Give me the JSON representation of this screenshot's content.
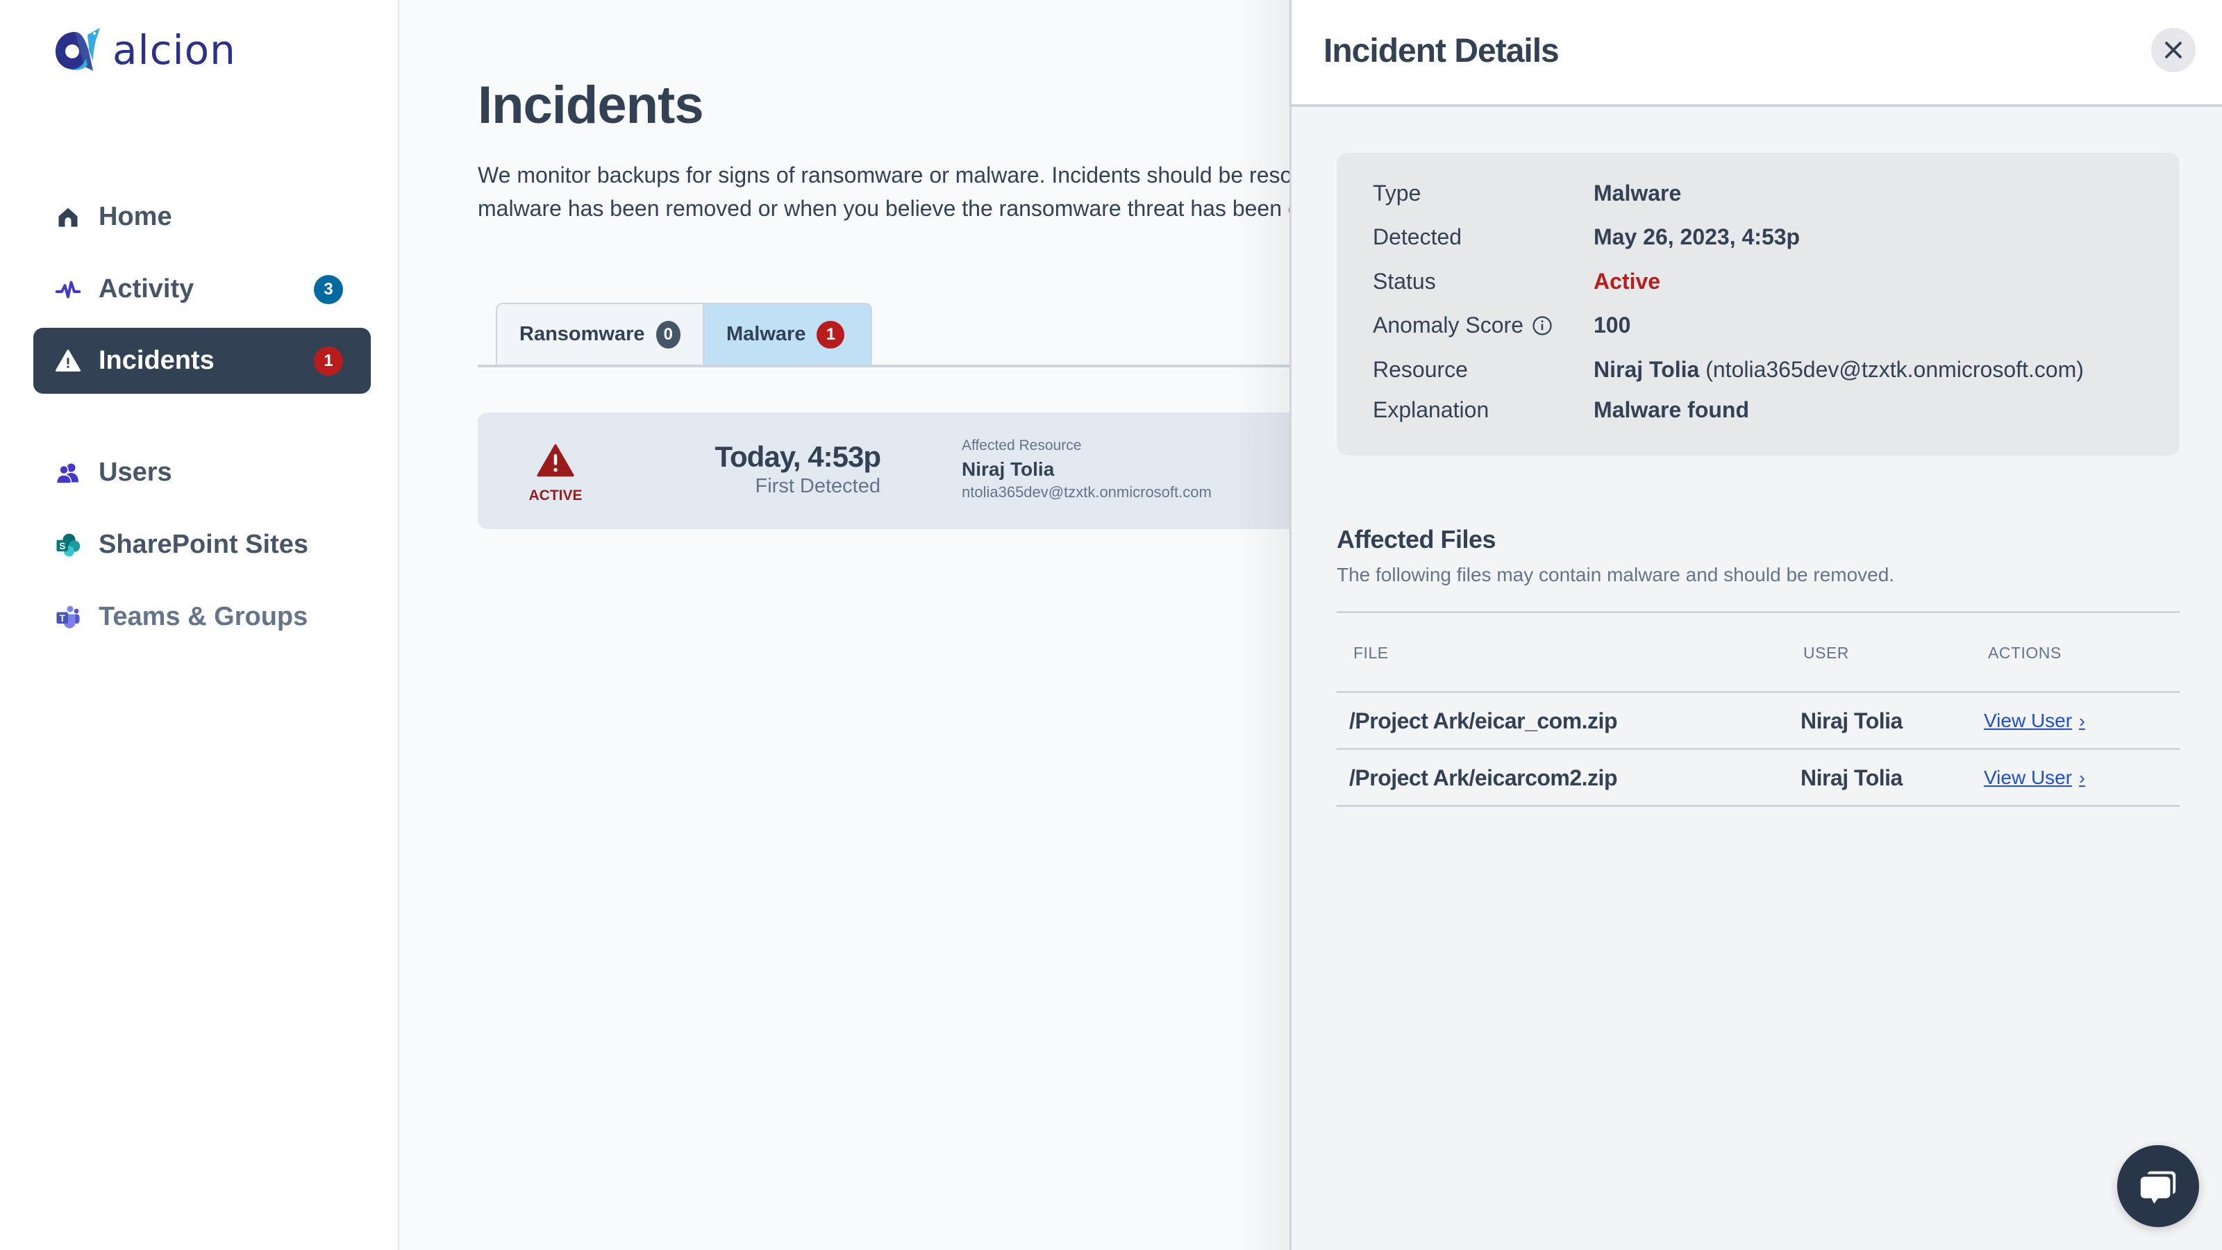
{
  "brand": {
    "name": "alcion",
    "logo_icon": "alcion-bird-logo"
  },
  "sidebar": {
    "items": [
      {
        "label": "Home",
        "icon": "home-icon",
        "badge": null,
        "active": false
      },
      {
        "label": "Activity",
        "icon": "activity-pulse-icon",
        "badge": "3",
        "active": false
      },
      {
        "label": "Incidents",
        "icon": "warning-triangle-icon",
        "badge": "1",
        "active": true
      },
      {
        "label": "Users",
        "icon": "users-icon",
        "badge": null,
        "active": false
      },
      {
        "label": "SharePoint Sites",
        "icon": "sharepoint-icon",
        "badge": null,
        "active": false
      },
      {
        "label": "Teams & Groups",
        "icon": "teams-icon",
        "badge": null,
        "active": false
      }
    ]
  },
  "main": {
    "title": "Incidents",
    "description": "We monitor backups for signs of ransomware or malware. Incidents should be resolved when malware has been removed or when you believe the ransomware threat has been eliminated.",
    "tabs": [
      {
        "label": "Ransomware",
        "count": "0",
        "selected": false
      },
      {
        "label": "Malware",
        "count": "1",
        "selected": true
      }
    ],
    "incident": {
      "status": "ACTIVE",
      "time": "Today, 4:53p",
      "time_label": "First Detected",
      "resource_label": "Affected Resource",
      "resource_name": "Niraj Tolia",
      "resource_email": "ntolia365dev@tzxtk.onmicrosoft.com"
    }
  },
  "panel": {
    "title": "Incident Details",
    "close_icon": "close-icon",
    "details": {
      "type_label": "Type",
      "type_value": "Malware",
      "detected_label": "Detected",
      "detected_value": "May 26, 2023, 4:53p",
      "status_label": "Status",
      "status_value": "Active",
      "score_label": "Anomaly Score",
      "score_value": "100",
      "resource_label": "Resource",
      "resource_name": "Niraj Tolia",
      "resource_email": "(ntolia365dev@tzxtk.onmicrosoft.com)",
      "explanation_label": "Explanation",
      "explanation_value": "Malware found"
    },
    "files": {
      "heading": "Affected Files",
      "subtext": "The following files may contain malware and should be removed.",
      "columns": [
        "FILE",
        "USER",
        "ACTIONS"
      ],
      "rows": [
        {
          "file": "/Project Ark/eicar_com.zip",
          "user": "Niraj Tolia",
          "action": "View User"
        },
        {
          "file": "/Project Ark/eicarcom2.zip",
          "user": "Niraj Tolia",
          "action": "View User"
        }
      ]
    }
  },
  "colors": {
    "nav_active_bg": "#334155",
    "badge_blue": "#0369a1",
    "badge_red": "#b91c1c",
    "status_active": "#b91c1c",
    "tab_selected_bg": "#bfe0f5",
    "link": "#1d4ed8"
  }
}
